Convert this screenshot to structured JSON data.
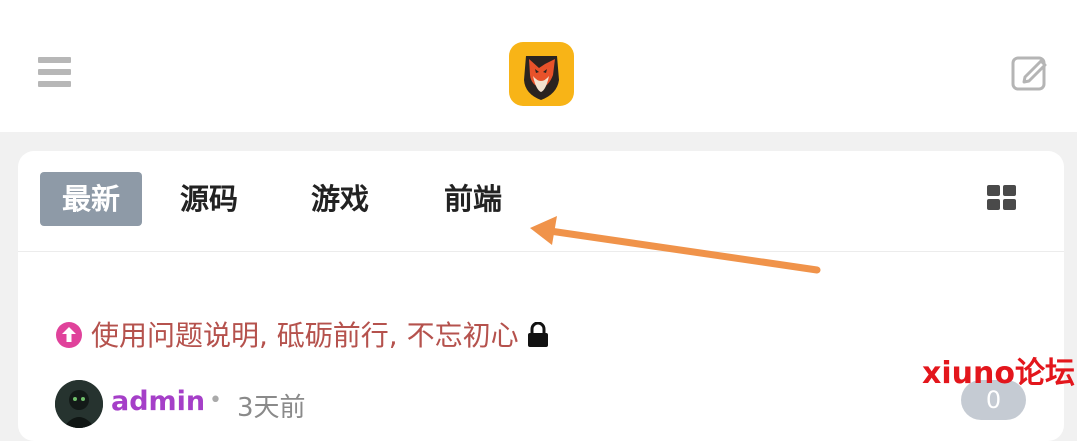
{
  "header": {
    "menu_icon": "hamburger-menu-icon",
    "logo_icon": "fox-logo",
    "edit_icon": "edit-note-icon"
  },
  "tabs": [
    {
      "label": "最新",
      "active": true
    },
    {
      "label": "源码",
      "active": false
    },
    {
      "label": "游戏",
      "active": false
    },
    {
      "label": "前端",
      "active": false
    }
  ],
  "view_toggle_icon": "grid-view-icon",
  "annotation": {
    "color": "#f0934a"
  },
  "thread": {
    "title": "使用问题说明, 砥砺前行, 不忘初心",
    "sticky_icon": "arrow-up-circle-icon",
    "lock_icon": "lock-icon",
    "author": "admin",
    "separator": "•",
    "time": "3天前",
    "replies": "0"
  },
  "watermark": "xiuno论坛",
  "colors": {
    "title": "#b5524d",
    "author": "#a53fc8",
    "active_tab": "#8e9aa7",
    "watermark": "#e3161c"
  }
}
